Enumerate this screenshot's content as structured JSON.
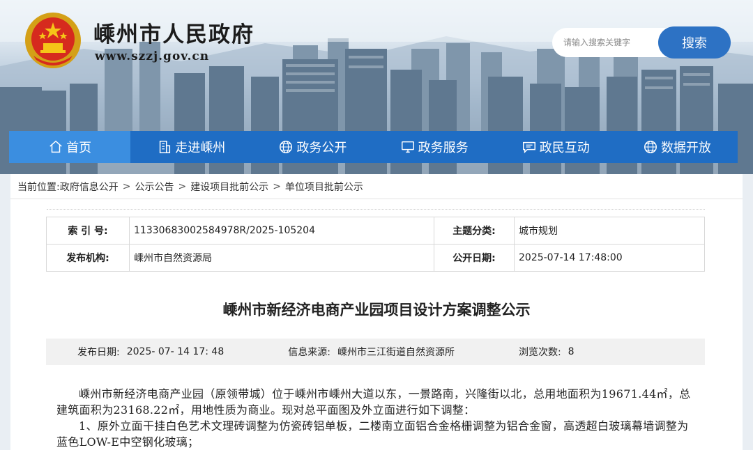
{
  "header": {
    "site_name": "嵊州市人民政府",
    "site_url": "www.szzj.gov.cn",
    "search_placeholder": "请输入搜索关键字",
    "search_button": "搜索"
  },
  "nav": [
    {
      "label": "首页",
      "icon": "home-icon"
    },
    {
      "label": "走进嵊州",
      "icon": "building-icon"
    },
    {
      "label": "政务公开",
      "icon": "globe-icon"
    },
    {
      "label": "政务服务",
      "icon": "monitor-icon"
    },
    {
      "label": "政民互动",
      "icon": "chat-icon"
    },
    {
      "label": "数据开放",
      "icon": "globe-icon"
    }
  ],
  "breadcrumb": {
    "prefix": "当前位置:",
    "items": [
      "政府信息公开",
      "公示公告",
      "建设项目批前公示",
      "单位项目批前公示"
    ],
    "separator": ">"
  },
  "meta": {
    "index_label": "索 引 号:",
    "index_value": "11330683002584978R/2025-105204",
    "category_label": "主题分类:",
    "category_value": "城市规划",
    "publisher_label": "发布机构:",
    "publisher_value": "嵊州市自然资源局",
    "open_date_label": "公开日期:",
    "open_date_value": "2025-07-14 17:48:00"
  },
  "article": {
    "title": "嵊州市新经济电商产业园项目设计方案调整公示",
    "publish_label": "发布日期:",
    "publish_value": "2025- 07- 14 17: 48",
    "source_label": "信息来源:",
    "source_value": "嵊州市三江街道自然资源所",
    "views_label": "浏览次数:",
    "views_value": "8",
    "paragraphs": [
      "嵊州市新经济电商产业园（原领带城）位于嵊州市嵊州大道以东，一景路南，兴隆街以北，总用地面积为19671.44㎡，总建筑面积为23168.22㎡，用地性质为商业。现对总平面图及外立面进行如下调整：",
      "1、原外立面干挂白色艺术文理砖调整为仿瓷砖铝单板，二楼南立面铝合金格栅调整为铝合金窗，高透超白玻璃幕墙调整为蓝色LOW-E中空钢化玻璃；"
    ]
  },
  "colors": {
    "nav_bg": "#1f6dc4",
    "nav_active": "#3b8ee0",
    "search_button": "#2d72c4"
  }
}
